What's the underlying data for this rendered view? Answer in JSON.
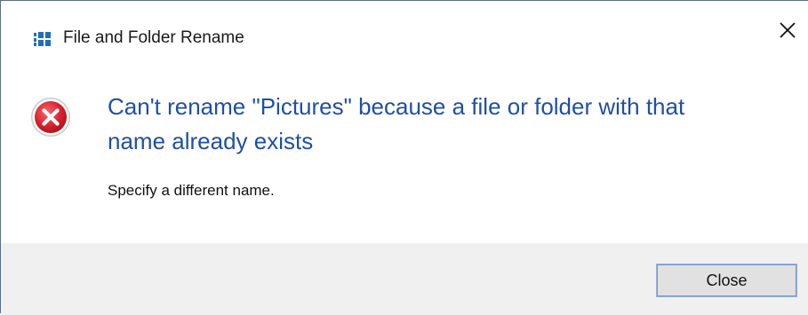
{
  "window": {
    "title": "File and Folder Rename",
    "close_glyph": "✕",
    "app_icon": "windows-logo-icon",
    "close_icon": "close-icon"
  },
  "message": {
    "icon": "error-icon",
    "main_line_1": "Can't rename \"Pictures\" because a file or folder with that",
    "main_line_2": "name already exists",
    "detail": "Specify a different name."
  },
  "buttons": {
    "close_label": "Close"
  },
  "colors": {
    "main_instruction": "#1f4fa6",
    "error_red": "#d9232e",
    "footer_bg": "#f0f0f0",
    "window_icon_blue": "#1e6fb8"
  }
}
